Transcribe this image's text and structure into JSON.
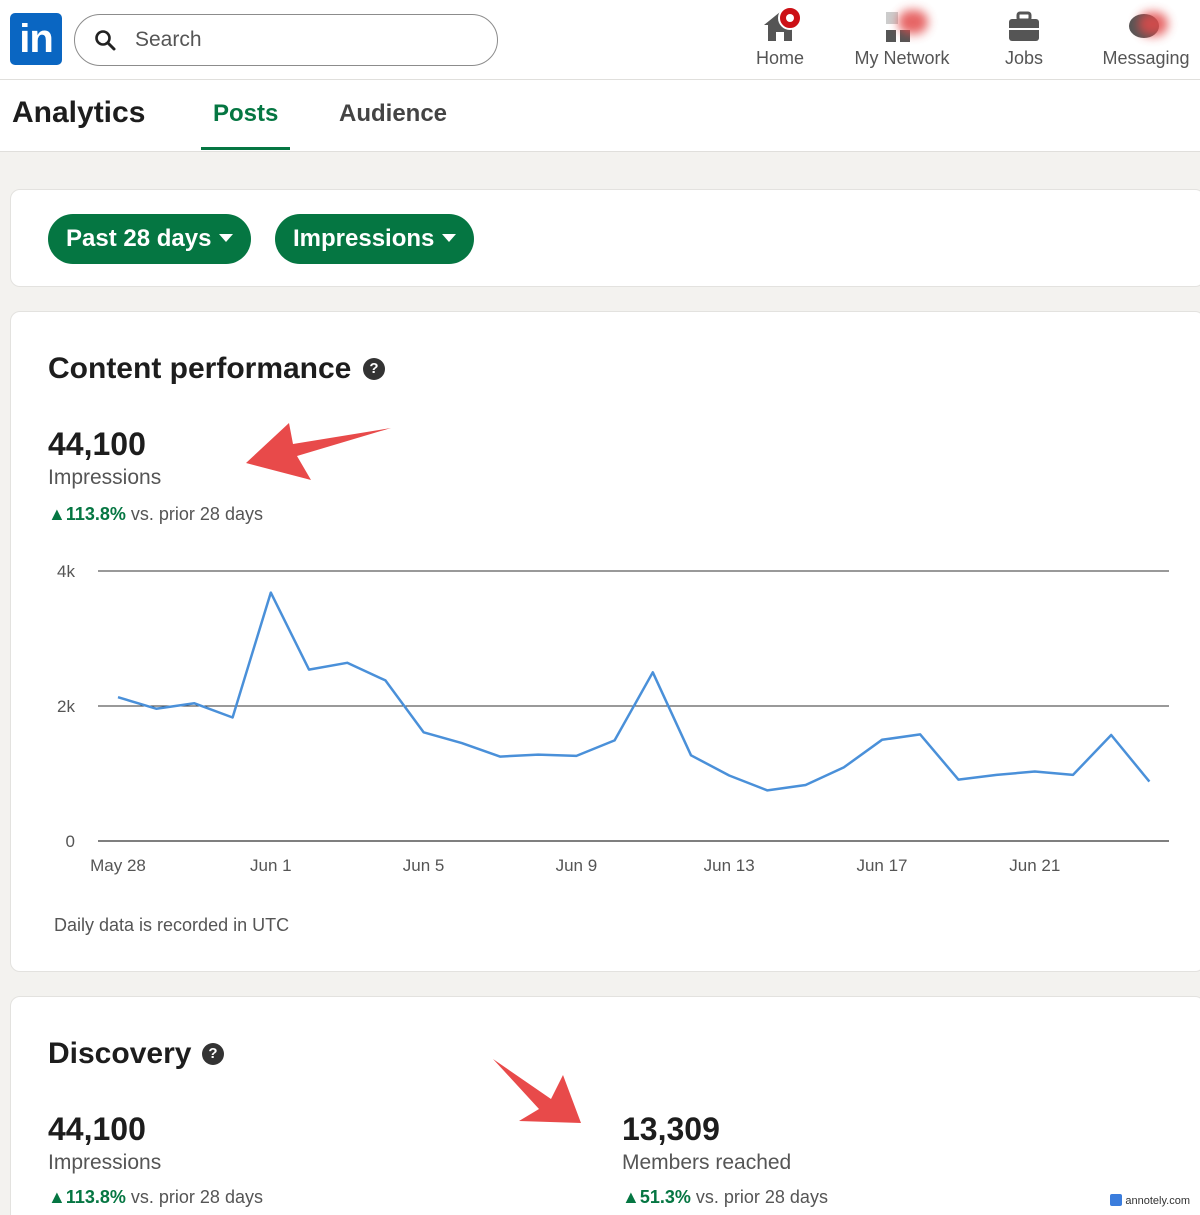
{
  "nav": {
    "logo": "in",
    "search_placeholder": "Search",
    "items": [
      {
        "label": "Home",
        "icon": "home-icon"
      },
      {
        "label": "My Network",
        "icon": "network-icon"
      },
      {
        "label": "Jobs",
        "icon": "briefcase-icon"
      },
      {
        "label": "Messaging",
        "icon": "messaging-icon"
      }
    ]
  },
  "header": {
    "title": "Analytics",
    "tabs": [
      {
        "label": "Posts",
        "active": true
      },
      {
        "label": "Audience",
        "active": false
      }
    ]
  },
  "filters": {
    "range": "Past 28 days",
    "metric": "Impressions"
  },
  "content_performance": {
    "title": "Content performance",
    "value": "44,100",
    "label": "Impressions",
    "delta_value": "113.8%",
    "delta_text": "vs. prior 28 days",
    "footnote": "Daily data is recorded in UTC"
  },
  "discovery": {
    "title": "Discovery",
    "impressions": {
      "value": "44,100",
      "label": "Impressions",
      "delta_value": "113.8%",
      "delta_text": "vs. prior 28 days"
    },
    "members": {
      "value": "13,309",
      "label": "Members reached",
      "delta_value": "51.3%",
      "delta_text": "vs. prior 28 days"
    }
  },
  "watermark": "annotely.com",
  "colors": {
    "accent": "#057642",
    "line": "#4a90d9",
    "logo": "#0a66c2",
    "arrow": "#e84a4a"
  },
  "chart_data": {
    "type": "line",
    "ylim": [
      0,
      4000
    ],
    "yticks": [
      "0",
      "2k",
      "4k"
    ],
    "xticks": [
      "May 28",
      "Jun 1",
      "Jun 5",
      "Jun 9",
      "Jun 13",
      "Jun 17",
      "Jun 21"
    ],
    "x": [
      "May 28",
      "May 29",
      "May 30",
      "May 31",
      "Jun 1",
      "Jun 2",
      "Jun 3",
      "Jun 4",
      "Jun 5",
      "Jun 6",
      "Jun 7",
      "Jun 8",
      "Jun 9",
      "Jun 10",
      "Jun 11",
      "Jun 12",
      "Jun 13",
      "Jun 14",
      "Jun 15",
      "Jun 16",
      "Jun 17",
      "Jun 18",
      "Jun 19",
      "Jun 20",
      "Jun 21",
      "Jun 22",
      "Jun 23",
      "Jun 24"
    ],
    "series": [
      {
        "values": [
          2130,
          1960,
          2040,
          1830,
          3680,
          2540,
          2640,
          2380,
          1610,
          1450,
          1250,
          1280,
          1260,
          1490,
          2500,
          1270,
          970,
          750,
          830,
          1090,
          1500,
          1580,
          910,
          980,
          1030,
          980,
          1570,
          880
        ]
      }
    ]
  }
}
